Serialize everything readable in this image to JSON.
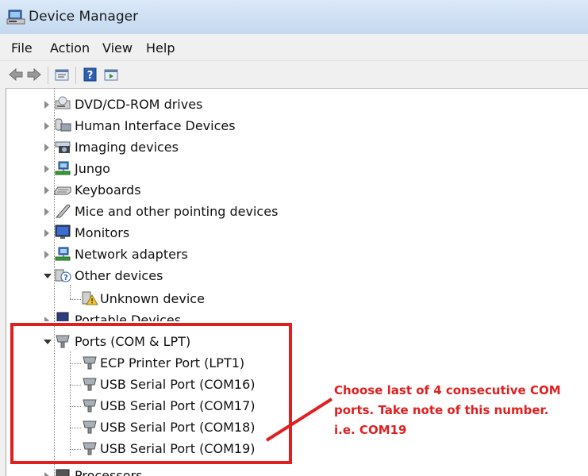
{
  "window": {
    "title": "Device Manager"
  },
  "menu": [
    "File",
    "Action",
    "View",
    "Help"
  ],
  "toolbar": {
    "buttons": [
      "back-icon",
      "forward-icon",
      "properties-icon",
      "help-icon",
      "view-icon"
    ]
  },
  "tree": {
    "categories": [
      {
        "label": "DVD/CD-ROM drives",
        "icon": "dvd-drive-icon",
        "state": "collapsed"
      },
      {
        "label": "Human Interface Devices",
        "icon": "hid-icon",
        "state": "collapsed"
      },
      {
        "label": "Imaging devices",
        "icon": "camera-icon",
        "state": "collapsed"
      },
      {
        "label": "Jungo",
        "icon": "network-icon",
        "state": "collapsed"
      },
      {
        "label": "Keyboards",
        "icon": "keyboard-icon",
        "state": "collapsed"
      },
      {
        "label": "Mice and other pointing devices",
        "icon": "mouse-icon",
        "state": "collapsed"
      },
      {
        "label": "Monitors",
        "icon": "monitor-icon",
        "state": "collapsed"
      },
      {
        "label": "Network adapters",
        "icon": "network-icon",
        "state": "collapsed"
      },
      {
        "label": "Other devices",
        "icon": "unknown-device-icon",
        "state": "expanded",
        "children": [
          {
            "label": "Unknown device",
            "icon": "warning-device-icon"
          }
        ]
      },
      {
        "label": "Portable Devices",
        "icon": "portable-device-icon",
        "state": "collapsed"
      },
      {
        "label": "Ports (COM & LPT)",
        "icon": "port-icon",
        "state": "expanded",
        "children": [
          {
            "label": "ECP Printer Port (LPT1)",
            "icon": "port-icon"
          },
          {
            "label": "USB Serial Port (COM16)",
            "icon": "port-icon"
          },
          {
            "label": "USB Serial Port (COM17)",
            "icon": "port-icon"
          },
          {
            "label": "USB Serial Port (COM18)",
            "icon": "port-icon"
          },
          {
            "label": "USB Serial Port (COM19)",
            "icon": "port-icon"
          }
        ]
      },
      {
        "label": "Processors",
        "icon": "processor-icon",
        "state": "collapsed"
      }
    ]
  },
  "annotation": {
    "lines": [
      "Choose last of 4 consecutive COM",
      "ports. Take note of this number.",
      "i.e. COM19"
    ],
    "color": "#e02020"
  }
}
